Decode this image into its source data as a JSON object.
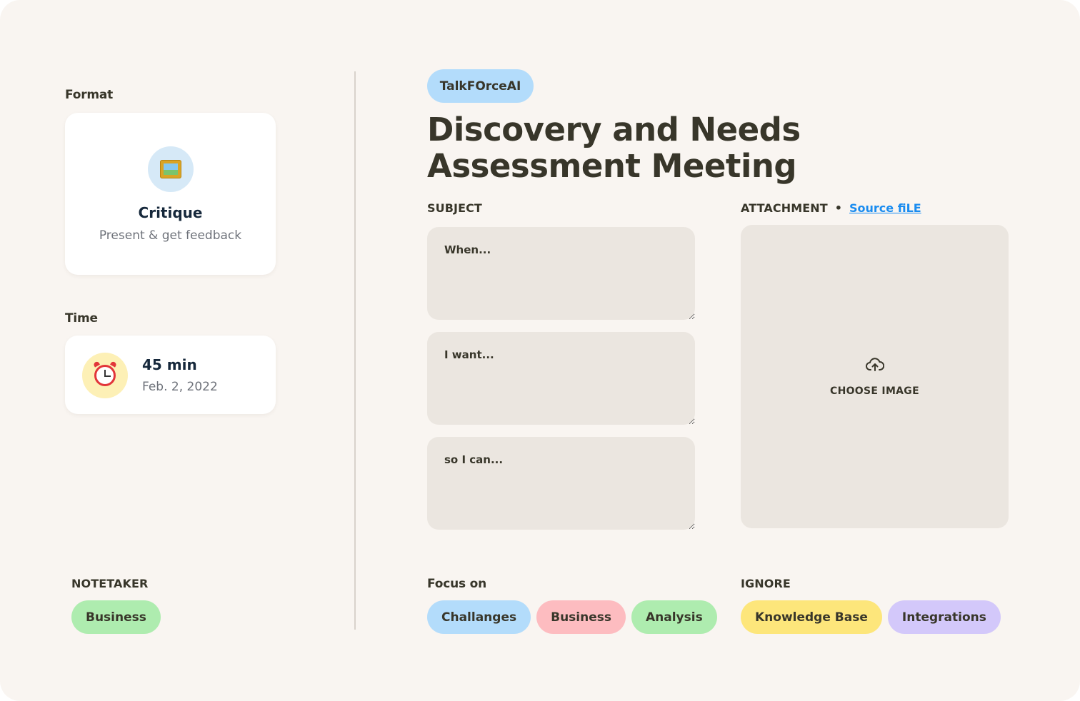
{
  "format": {
    "label": "Format",
    "icon": "framed-picture-icon",
    "title": "Critique",
    "subtitle": "Present & get feedback"
  },
  "time": {
    "label": "Time",
    "icon": "alarm-clock-icon",
    "duration": "45 min",
    "date": "Feb. 2, 2022"
  },
  "notetaker": {
    "label": "NOTETAKER",
    "chip": "Business",
    "chip_color": "#aeecaf"
  },
  "brand": {
    "label": "TalkFOrceAI",
    "color": "#b3dcfb"
  },
  "meeting": {
    "title": "Discovery and Needs Assessment Meeting"
  },
  "subject": {
    "label": "SUBJECT",
    "fields": [
      {
        "placeholder": "When..."
      },
      {
        "placeholder": "I want..."
      },
      {
        "placeholder": "so I can..."
      }
    ]
  },
  "attachment": {
    "label": "ATTACHMENT",
    "separator": "•",
    "link": "Source fiLE",
    "link_color": "#1a8cf0",
    "choose_label": "CHOOSE IMAGE",
    "icon": "cloud-upload-icon"
  },
  "focus": {
    "label": "Focus on",
    "chips": [
      {
        "label": "Challanges",
        "color": "#b3dcfb"
      },
      {
        "label": "Business",
        "color": "#fdbcc0"
      },
      {
        "label": "Analysis",
        "color": "#aeecaf"
      }
    ]
  },
  "ignore": {
    "label": "IGNORE",
    "chips": [
      {
        "label": "Knowledge Base",
        "color": "#fde67b"
      },
      {
        "label": "Integrations",
        "color": "#d3c8fa"
      }
    ]
  },
  "colors": {
    "background": "#f9f5f1",
    "text": "#38362a",
    "field": "#ebe6e0"
  }
}
